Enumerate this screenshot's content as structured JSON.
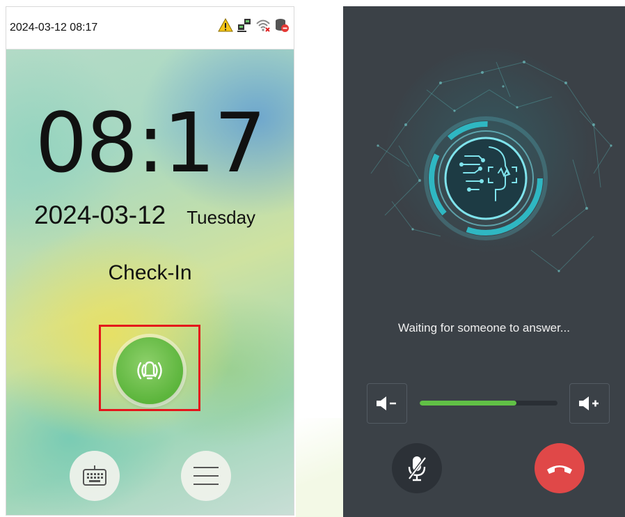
{
  "left_screen": {
    "status_bar": {
      "datetime": "2024-03-12 08:17",
      "icons": [
        "warning-icon",
        "network-icon",
        "wifi-disconnected-icon",
        "cloud-server-icon"
      ]
    },
    "clock": {
      "time": "08:17",
      "date": "2024-03-12",
      "weekday": "Tuesday"
    },
    "attendance_mode": "Check-In",
    "doorbell_icon": "doorbell-icon",
    "bottom_buttons": [
      "keyboard-icon",
      "menu-icon"
    ],
    "colors": {
      "doorbell": "#5cb53c",
      "highlight": "#e4151b"
    }
  },
  "right_screen": {
    "status_message": "Waiting for someone to answer...",
    "volume_level": 0.7,
    "controls": [
      "volume-down-icon",
      "volume-up-icon",
      "mute-microphone-icon",
      "hang-up-icon"
    ],
    "colors": {
      "background": "#3b4147",
      "volume_fill": "#61c146",
      "hang_up": "#e04848"
    }
  }
}
